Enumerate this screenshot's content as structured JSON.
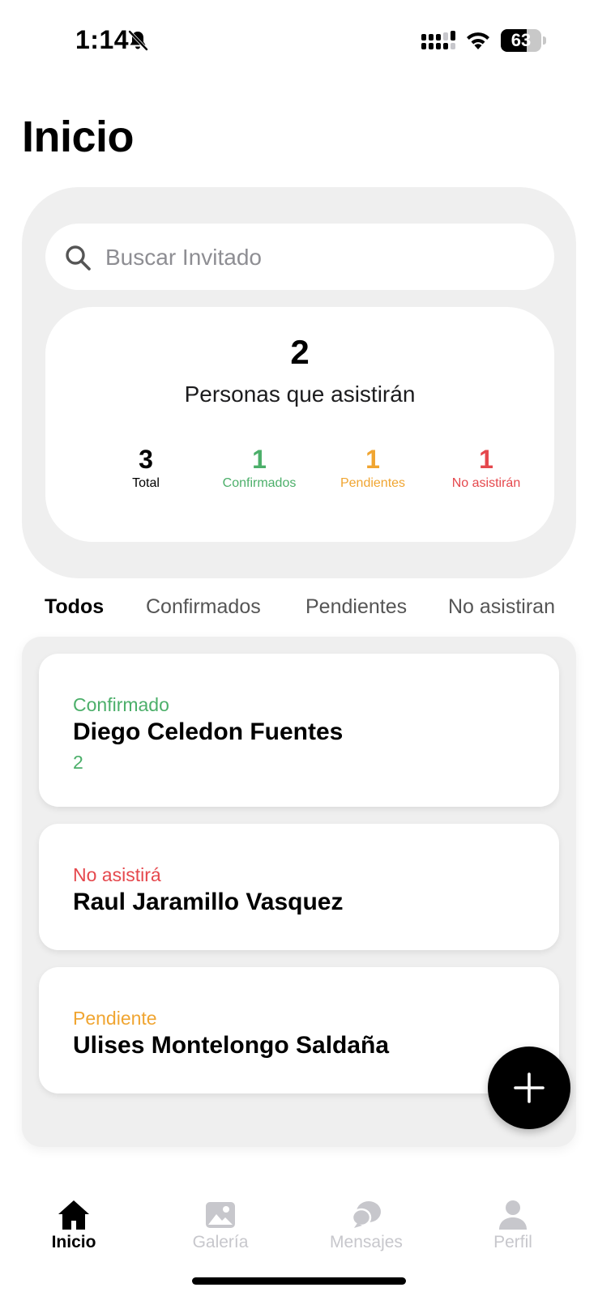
{
  "status_bar": {
    "time": "1:14",
    "battery_level": "63",
    "battery_fraction": 0.63
  },
  "page": {
    "title": "Inicio"
  },
  "search": {
    "placeholder": "Buscar Invitado",
    "value": ""
  },
  "summary": {
    "attending_count": "2",
    "attending_label": "Personas que asistirán",
    "stats": [
      {
        "value": "3",
        "label": "Total",
        "color": "#000000"
      },
      {
        "value": "1",
        "label": "Confirmados",
        "color": "#4caf6a"
      },
      {
        "value": "1",
        "label": "Pendientes",
        "color": "#f0a531"
      },
      {
        "value": "1",
        "label": "No asistirán",
        "color": "#e5484d"
      }
    ]
  },
  "filters": {
    "tabs": [
      {
        "label": "Todos",
        "active": true
      },
      {
        "label": "Confirmados",
        "active": false
      },
      {
        "label": "Pendientes",
        "active": false
      },
      {
        "label": "No asistiran",
        "active": false
      }
    ]
  },
  "guests": [
    {
      "status": "Confirmado",
      "status_color": "#4caf6a",
      "name": "Diego Celedon Fuentes",
      "count": "2"
    },
    {
      "status": "No asistirá",
      "status_color": "#e5484d",
      "name": "Raul Jaramillo Vasquez"
    },
    {
      "status": "Pendiente",
      "status_color": "#f0a531",
      "name": "Ulises Montelongo Saldaña"
    }
  ],
  "fab": {
    "icon": "plus-icon"
  },
  "bottom_nav": {
    "items": [
      {
        "label": "Inicio",
        "icon": "home-icon",
        "active": true
      },
      {
        "label": "Galería",
        "icon": "gallery-icon",
        "active": false
      },
      {
        "label": "Mensajes",
        "icon": "messages-icon",
        "active": false
      },
      {
        "label": "Perfil",
        "icon": "profile-icon",
        "active": false
      }
    ]
  },
  "colors": {
    "accent": "#000000",
    "confirmed": "#4caf6a",
    "pending": "#f0a531",
    "declined": "#e5484d",
    "inactive": "#c7c7cc"
  }
}
